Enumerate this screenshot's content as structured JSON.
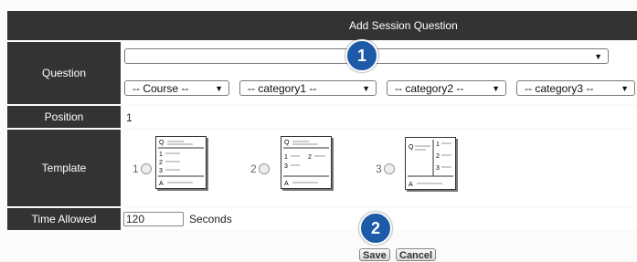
{
  "header": {
    "title": "Add Session Question"
  },
  "question": {
    "label": "Question",
    "selected": "",
    "filters": [
      {
        "value": "-- Course --"
      },
      {
        "value": "-- category1 --"
      },
      {
        "value": "-- category2 --"
      },
      {
        "value": "-- category3 --"
      }
    ]
  },
  "position": {
    "label": "Position",
    "value": "1"
  },
  "template": {
    "label": "Template",
    "options": [
      {
        "number": "1",
        "marks": [
          "Q",
          "1",
          "2",
          "3",
          "A"
        ]
      },
      {
        "number": "2",
        "marks": [
          "Q",
          "1",
          "2",
          "3",
          "A"
        ]
      },
      {
        "number": "3",
        "marks": [
          "Q",
          "1",
          "2",
          "3",
          "A"
        ]
      }
    ]
  },
  "time_allowed": {
    "label": "Time Allowed",
    "value": "120",
    "unit": "Seconds"
  },
  "actions": {
    "save": "Save",
    "cancel": "Cancel"
  },
  "callouts": {
    "one": "1",
    "two": "2"
  },
  "colors": {
    "label_bg": "#333333",
    "badge_bg": "#1d5aa8"
  }
}
